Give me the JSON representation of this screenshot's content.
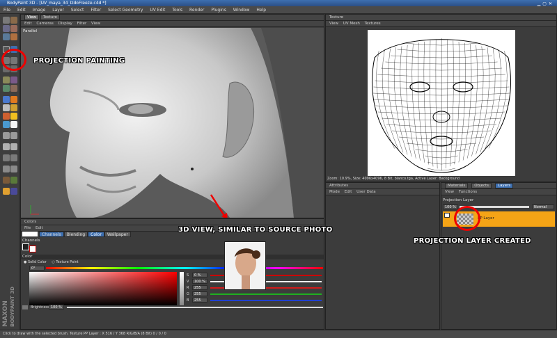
{
  "window": {
    "title": "BodyPaint 3D - [UV_maya_34_IzdoFreeze.c4d *]"
  },
  "menu": [
    "File",
    "Edit",
    "Image",
    "Layer",
    "Select",
    "Filter",
    "Select Geometry",
    "UV Edit",
    "Tools",
    "Render",
    "Plugins",
    "Window",
    "Help"
  ],
  "viewport": {
    "tabs": [
      "View",
      "Texture"
    ],
    "menu": [
      "Edit",
      "Cameras",
      "Display",
      "Filter",
      "View"
    ],
    "mode_label": "Parallel"
  },
  "texture_view": {
    "title": "Texture",
    "menu": [
      "View",
      "UV Mesh",
      "Textures"
    ],
    "status": "Zoom: 10.9%, Size: 4096x4096, 8 Bit, blanco.tga, Active Layer: Background"
  },
  "colors_panel": {
    "title": "Colors",
    "menu": [
      "File",
      "Edit"
    ],
    "tabs": [
      "Channels",
      "Blending",
      "Color",
      "Wallpaper"
    ],
    "active_tab": "Color",
    "section_channels": "Channels",
    "section_color": "Color",
    "mode_options": [
      "Solid Color",
      "Texture Paint"
    ],
    "hue_value": "0°",
    "brightness_label": "Brightness",
    "brightness_value": "100 %",
    "fields": [
      {
        "label": "S",
        "value": "0 %",
        "color": "#cc0000"
      },
      {
        "label": "V",
        "value": "100 %",
        "color": "#ffffff"
      },
      {
        "label": "R",
        "value": "255",
        "color": "#d21a1a"
      },
      {
        "label": "G",
        "value": "255",
        "color": "#20b020"
      },
      {
        "label": "B",
        "value": "255",
        "color": "#2040d0"
      }
    ]
  },
  "attributes_panel": {
    "title": "Attributes",
    "menu": [
      "Mode",
      "Edit",
      "User Data"
    ]
  },
  "layers_panel": {
    "tabs": [
      "Materials",
      "Objects",
      "Layers"
    ],
    "active_tab": "Layers",
    "menu": [
      "View",
      "Functions"
    ],
    "section_label": "Projection Layer",
    "opacity": "100 %",
    "blend_mode": "Normal",
    "layer_name": "PP Layer",
    "layer_color": "#f5a416"
  },
  "statusbar": {
    "text": "Click to draw with the selected brush. Texture PP Layer : X 516 / Y 368 R/G/B/A (8 Bit) 0 / 0 / 0"
  },
  "branding": {
    "line1": "MAXON",
    "line2": "BODYPAINT 3D"
  },
  "annotations": {
    "projection_painting": "PROJECTION PAINTING",
    "view_3d": "3D VIEW, SIMILAR TO SOURCE PHOTO",
    "layer_created": "PROJECTION LAYER CREATED"
  }
}
